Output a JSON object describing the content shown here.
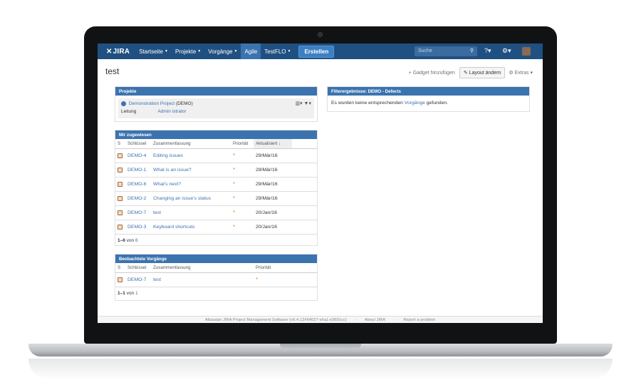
{
  "topnav": {
    "logo": "JIRA",
    "items": [
      {
        "label": "Startseite",
        "caret": true
      },
      {
        "label": "Projekte",
        "caret": true
      },
      {
        "label": "Vorgänge",
        "caret": true
      },
      {
        "label": "Agile",
        "caret": false
      },
      {
        "label": "TestFLO",
        "caret": true
      }
    ],
    "create_label": "Erstellen",
    "search_placeholder": "Suche"
  },
  "page": {
    "title": "test",
    "add_gadget": "Gadget hinzufügen",
    "change_layout": "Layout ändern",
    "extras": "Extras"
  },
  "projects": {
    "title": "Projekte",
    "project_name": "Demonstration Project",
    "project_key": "(DEMO)",
    "lead_label": "Leitung",
    "lead_value": "Admin istrator"
  },
  "assigned": {
    "title": "Mir zugewiesen",
    "columns": [
      "S",
      "Schlüssel",
      "Zusammenfassung",
      "Priorität",
      "Aktualisiert"
    ],
    "rows": [
      {
        "key": "DEMO-4",
        "summary": "Editing issues",
        "updated": "29/Mär/16"
      },
      {
        "key": "DEMO-1",
        "summary": "What is an issue?",
        "updated": "29/Mär/16"
      },
      {
        "key": "DEMO-6",
        "summary": "What's next?",
        "updated": "29/Mär/16"
      },
      {
        "key": "DEMO-2",
        "summary": "Changing an issue's status",
        "updated": "29/Mär/16"
      },
      {
        "key": "DEMO-7",
        "summary": "test",
        "updated": "20/Jan/16"
      },
      {
        "key": "DEMO-3",
        "summary": "Keyboard shortcuts",
        "updated": "20/Jan/16"
      }
    ],
    "count_range": "1–6",
    "count_of": "von",
    "count_total": "6"
  },
  "watched": {
    "title": "Beobachtete Vorgänge",
    "columns": [
      "S",
      "Schlüssel",
      "Zusammenfassung",
      "Priorität"
    ],
    "rows": [
      {
        "key": "DEMO-7",
        "summary": "test"
      }
    ],
    "count_range": "1–1",
    "count_of": "von",
    "count_total": "1"
  },
  "filter": {
    "title": "Filterergebnisse: DEMO - Defects",
    "text_before": "Es wurden keine entsprechenden",
    "link": "Vorgänge",
    "text_after": "gefunden."
  },
  "footer": {
    "version": "Atlassian JIRA Project Management Software (v6.4.12#64027-sha1:e3691cc)",
    "about": "About JIRA",
    "report": "Report a problem"
  }
}
